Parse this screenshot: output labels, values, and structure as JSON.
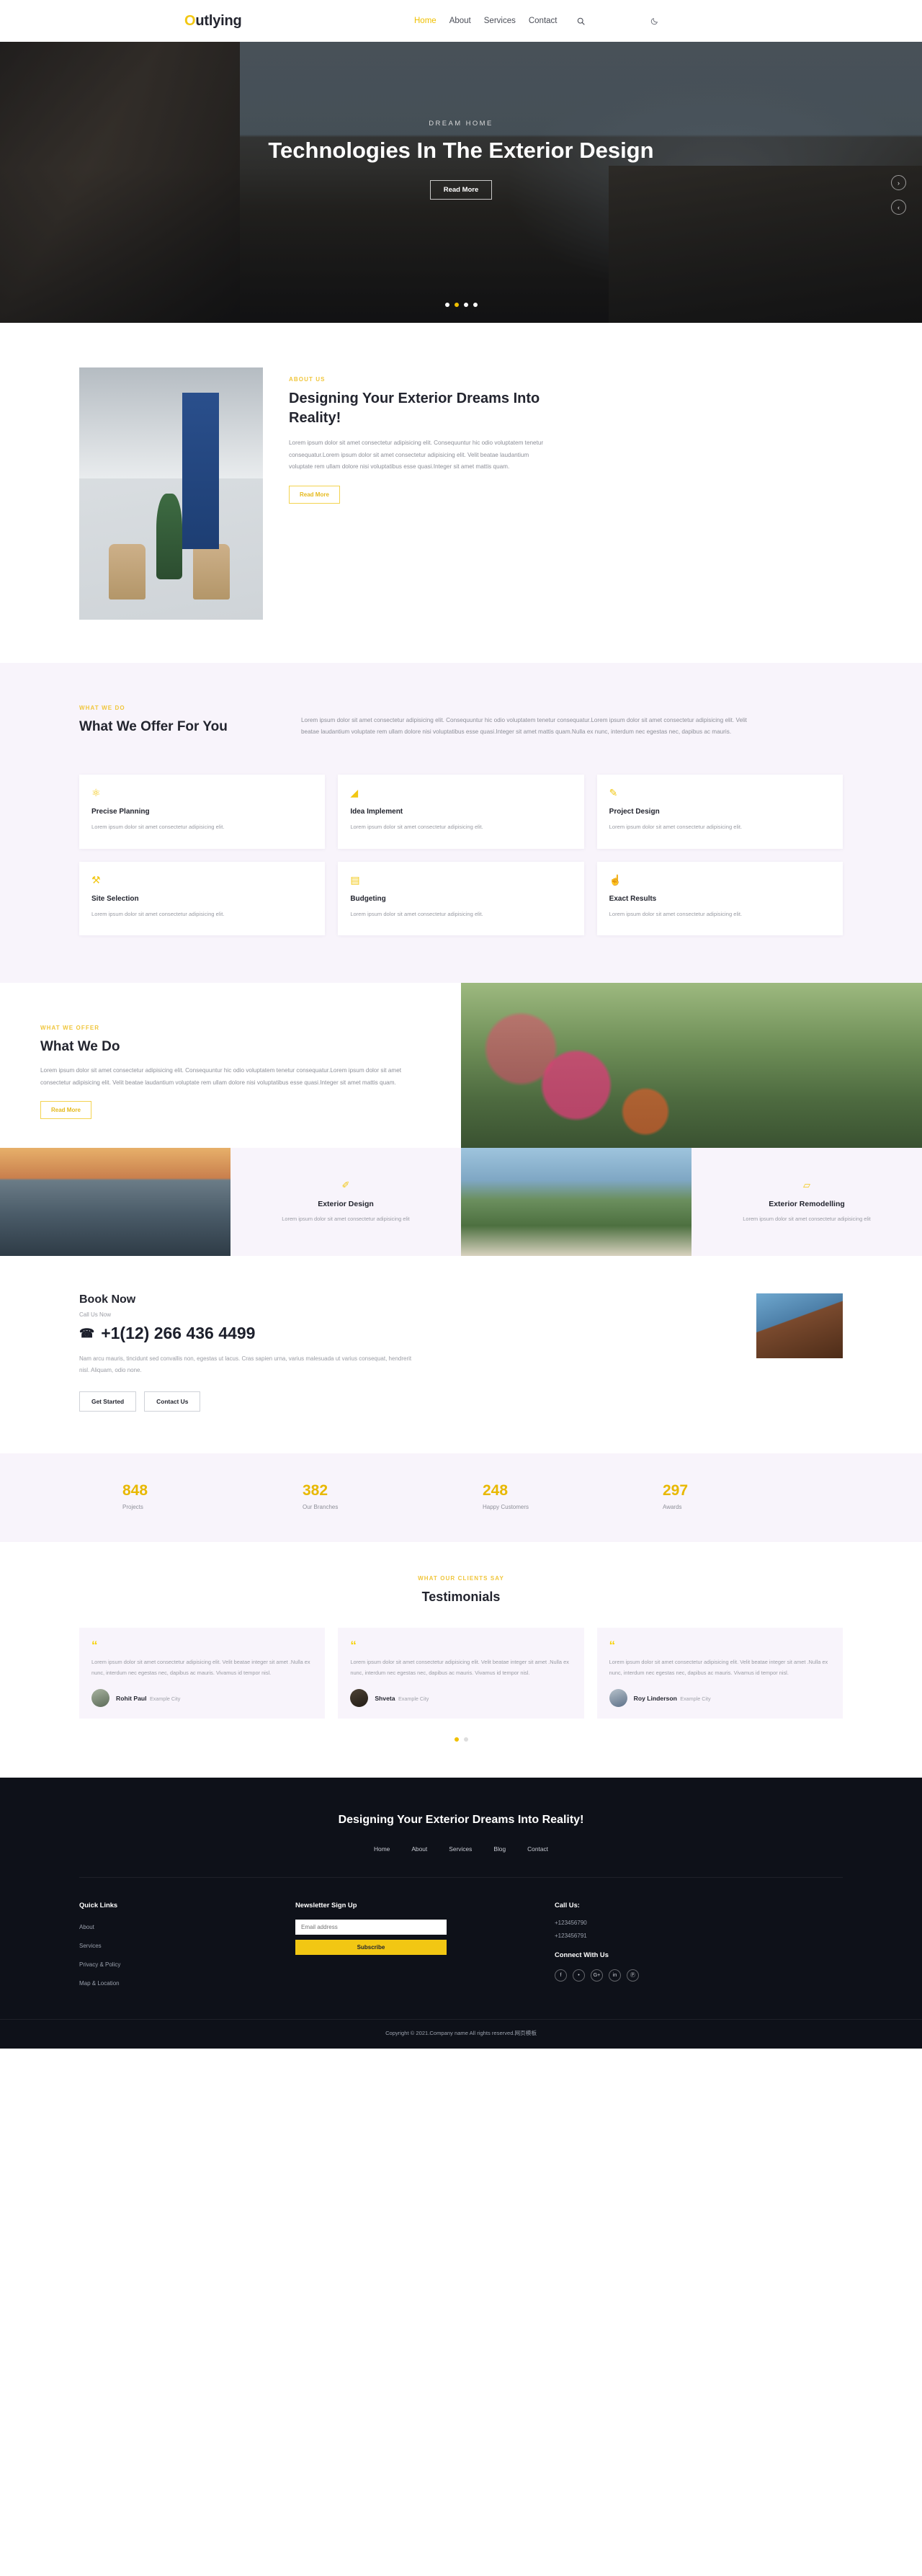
{
  "header": {
    "logo_first": "O",
    "logo_rest": "utlying",
    "nav": [
      {
        "label": "Home",
        "active": true
      },
      {
        "label": "About",
        "active": false
      },
      {
        "label": "Services",
        "active": false
      },
      {
        "label": "Contact",
        "active": false
      }
    ],
    "search_icon": "search-icon",
    "theme_icon": "moon-icon"
  },
  "hero": {
    "eyebrow": "DREAM HOME",
    "title": "Technologies In The Exterior Design",
    "button": "Read More",
    "next_arrow": "›",
    "prev_arrow": "‹",
    "dots": 4,
    "active_dot": 1
  },
  "about": {
    "eyebrow": "ABOUT US",
    "title": "Designing Your Exterior Dreams Into Reality!",
    "body": "Lorem ipsum dolor sit amet consectetur adipisicing elit. Consequuntur hic odio voluptatem tenetur consequatur.Lorem ipsum dolor sit amet consectetur adipisicing elit. Velit beatae laudantium voluptate rem ullam dolore nisi voluptatibus esse quasi.Integer sit amet mattis quam.",
    "button": "Read More"
  },
  "offer": {
    "eyebrow": "WHAT WE DO",
    "title": "What We Offer For You",
    "body": "Lorem ipsum dolor sit amet consectetur adipisicing elit. Consequuntur hic odio voluptatem tenetur consequatur.Lorem ipsum dolor sit amet consectetur adipisicing elit. Velit beatae laudantium voluptate rem ullam dolore nisi voluptatibus esse quasi.Integer sit amet mattis quam.Nulla ex nunc, interdum nec egestas nec, dapibus ac mauris.",
    "cards": [
      {
        "icon": "⚛",
        "icon_name": "molecule-icon",
        "title": "Precise Planning",
        "desc": "Lorem ipsum dolor sit amet consectetur adipisicing elit."
      },
      {
        "icon": "◢",
        "icon_name": "megaphone-icon",
        "title": "Idea Implement",
        "desc": "Lorem ipsum dolor sit amet consectetur adipisicing elit."
      },
      {
        "icon": "✎",
        "icon_name": "pencil-square-icon",
        "title": "Project Design",
        "desc": "Lorem ipsum dolor sit amet consectetur adipisicing elit."
      },
      {
        "icon": "⚒",
        "icon_name": "site-pin-icon",
        "title": "Site Selection",
        "desc": "Lorem ipsum dolor sit amet consectetur adipisicing elit."
      },
      {
        "icon": "▤",
        "icon_name": "briefcase-icon",
        "title": "Budgeting",
        "desc": "Lorem ipsum dolor sit amet consectetur adipisicing elit."
      },
      {
        "icon": "☝",
        "icon_name": "thumbs-up-icon",
        "title": "Exact Results",
        "desc": "Lorem ipsum dolor sit amet consectetur adipisicing elit."
      }
    ]
  },
  "whatwedo": {
    "eyebrow": "WHAT WE OFFER",
    "title": "What We Do",
    "body": "Lorem ipsum dolor sit amet consectetur adipisicing elit. Consequuntur hic odio voluptatem tenetur consequatur.Lorem ipsum dolor sit amet consectetur adipisicing elit. Velit beatae laudantium voluptate rem ullam dolore nisi voluptatibus esse quasi.Integer sit amet mattis quam.",
    "button": "Read More",
    "gallery_cards": [
      {
        "icon": "✐",
        "icon_name": "paintbrush-icon",
        "title": "Exterior Design",
        "desc": "Lorem ipsum dolor sit amet consectetur adipisicing elit"
      },
      {
        "icon": "▱",
        "icon_name": "trowel-icon",
        "title": "Exterior Remodelling",
        "desc": "Lorem ipsum dolor sit amet consectetur adipisicing elit"
      }
    ]
  },
  "booknow": {
    "title": "Book Now",
    "call_label": "Call Us Now",
    "phone_icon": "☎",
    "phone": "+1(12) 266 436 4499",
    "desc": "Nam arcu mauris, tincidunt sed convallis non, egestas ut lacus. Cras sapien urna, varius malesuada ut varius consequat, hendrerit nisl. Aliquam, odio none.",
    "buttons": [
      "Get Started",
      "Contact Us"
    ]
  },
  "stats": [
    {
      "value": "848",
      "label": "Projects"
    },
    {
      "value": "382",
      "label": "Our Branches"
    },
    {
      "value": "248",
      "label": "Happy Customers"
    },
    {
      "value": "297",
      "label": "Awards"
    }
  ],
  "testimonials": {
    "eyebrow": "WHAT OUR CLIENTS SAY",
    "title": "Testimonials",
    "quote_mark": "“",
    "items": [
      {
        "text": "Lorem ipsum dolor sit amet consectetur adipisicing elit. Velit beatae integer sit amet .Nulla ex nunc, interdum nec egestas nec, dapibus ac mauris. Vivamus id tempor nisl.",
        "name": "Rohit Paul",
        "city": "Example City"
      },
      {
        "text": "Lorem ipsum dolor sit amet consectetur adipisicing elit. Velit beatae integer sit amet .Nulla ex nunc, interdum nec egestas nec, dapibus ac mauris. Vivamus id tempor nisl.",
        "name": "Shveta",
        "city": "Example City"
      },
      {
        "text": "Lorem ipsum dolor sit amet consectetur adipisicing elit. Velit beatae integer sit amet .Nulla ex nunc, interdum nec egestas nec, dapibus ac mauris. Vivamus id tempor nisl.",
        "name": "Roy Linderson",
        "city": "Example City"
      }
    ],
    "dots": 2,
    "active_dot": 0
  },
  "footer": {
    "cta_title": "Designing Your Exterior Dreams Into Reality!",
    "nav": [
      "Home",
      "About",
      "Services",
      "Blog",
      "Contact"
    ],
    "quick_links_title": "Quick Links",
    "quick_links": [
      "About",
      "Services",
      "Privacy & Policy",
      "Map & Location"
    ],
    "newsletter_title": "Newsletter Sign Up",
    "newsletter_placeholder": "Email address",
    "subscribe_label": "Subscribe",
    "call_title": "Call Us:",
    "phones": [
      "+123456790",
      "+123456791"
    ],
    "connect_title": "Connect With Us",
    "socials": [
      {
        "glyph": "f",
        "name": "facebook-icon"
      },
      {
        "glyph": "•",
        "name": "twitter-icon"
      },
      {
        "glyph": "G+",
        "name": "google-plus-icon"
      },
      {
        "glyph": "in",
        "name": "linkedin-icon"
      },
      {
        "glyph": "Ⓟ",
        "name": "pinterest-icon"
      }
    ],
    "copyright": "Copyright © 2021.Company name All rights reserved.网页模板"
  },
  "colors": {
    "accent": "#f2c713",
    "dark": "#0e1119",
    "lilac": "#f8f4fb"
  }
}
